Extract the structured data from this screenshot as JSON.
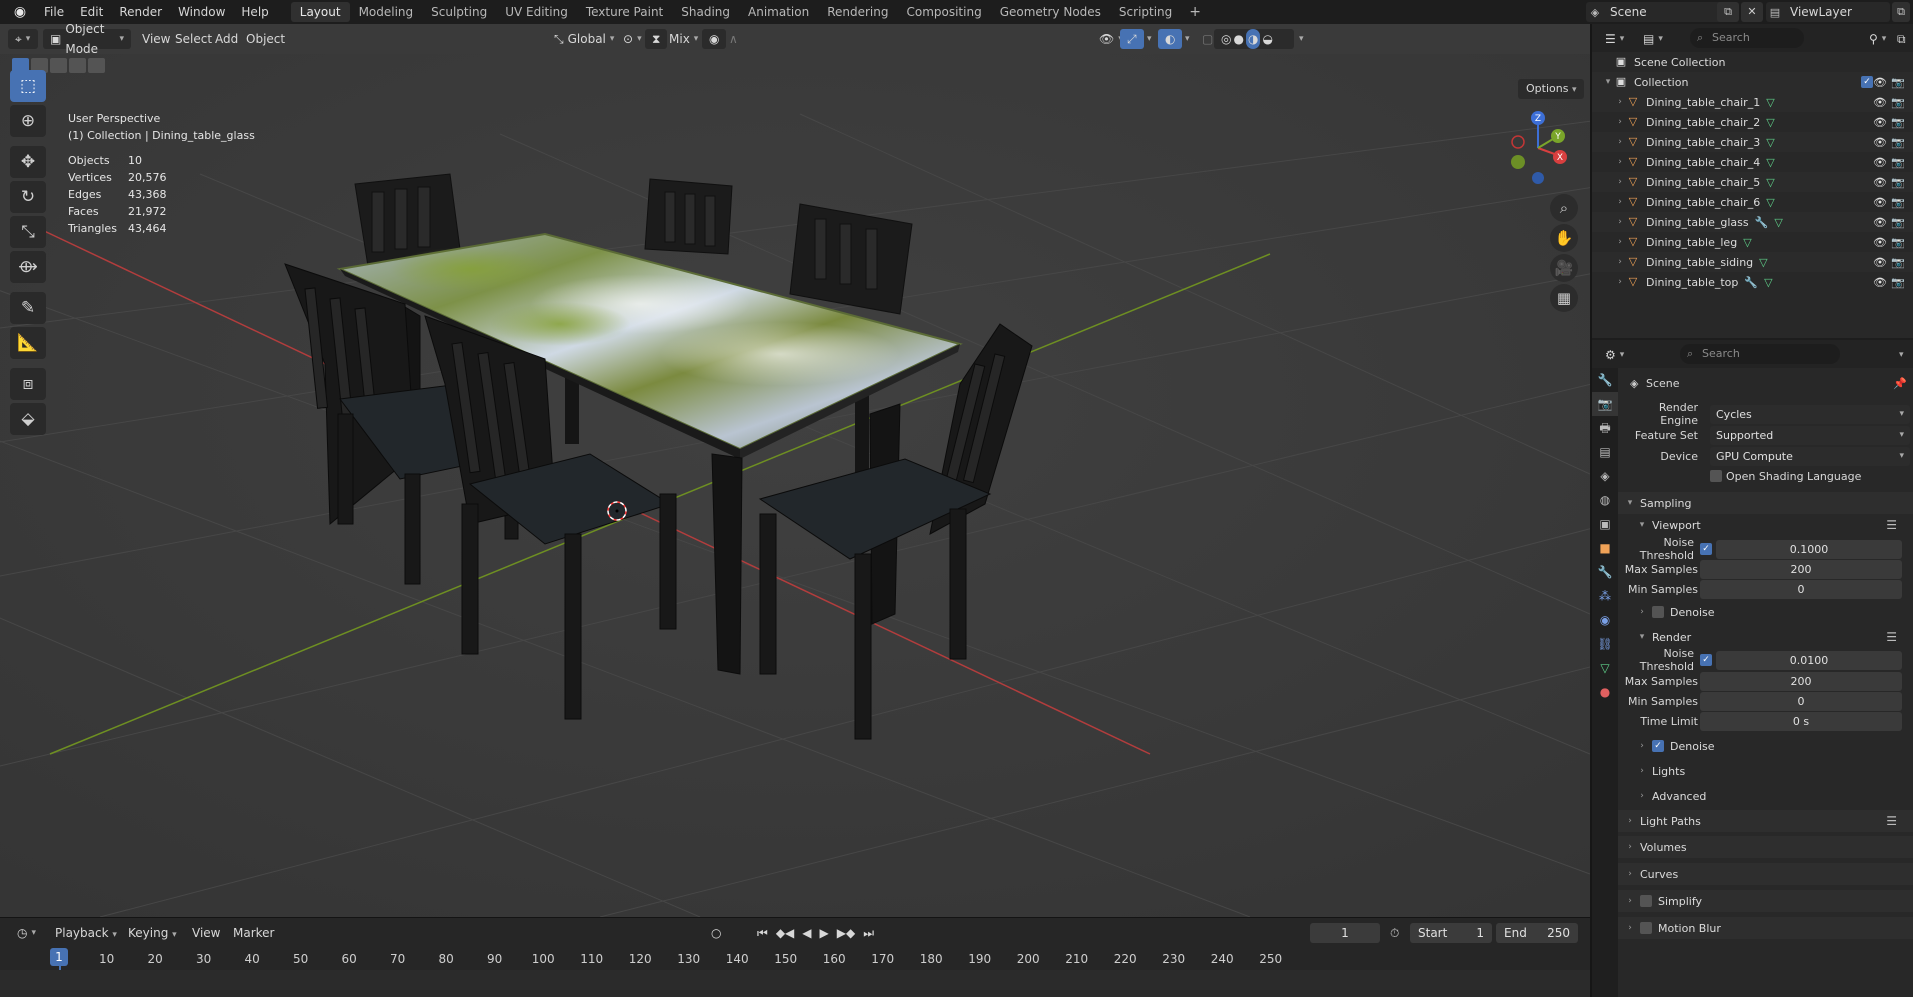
{
  "menu": [
    "File",
    "Edit",
    "Render",
    "Window",
    "Help"
  ],
  "workspaces": [
    "Layout",
    "Modeling",
    "Sculpting",
    "UV Editing",
    "Texture Paint",
    "Shading",
    "Animation",
    "Rendering",
    "Compositing",
    "Geometry Nodes",
    "Scripting"
  ],
  "active_workspace": "Layout",
  "scene_name": "Scene",
  "view_layer": "ViewLayer",
  "viewport": {
    "mode": "Object Mode",
    "menus": [
      "View",
      "Select",
      "Add",
      "Object"
    ],
    "orientation": "Global",
    "snap_mode": "Mix",
    "options_label": "Options",
    "view_name": "User Perspective",
    "context": "(1) Collection | Dining_table_glass",
    "stats": [
      {
        "label": "Objects",
        "value": "10"
      },
      {
        "label": "Vertices",
        "value": "20,576"
      },
      {
        "label": "Edges",
        "value": "43,368"
      },
      {
        "label": "Faces",
        "value": "21,972"
      },
      {
        "label": "Triangles",
        "value": "43,464"
      }
    ],
    "gizmo": {
      "x": "X",
      "y": "Y",
      "z": "Z"
    }
  },
  "timeline": {
    "menus": [
      "Playback",
      "Keying",
      "View",
      "Marker"
    ],
    "current_frame": "1",
    "start_label": "Start",
    "start": "1",
    "end_label": "End",
    "end": "250",
    "ticks": [
      "1",
      "10",
      "20",
      "30",
      "40",
      "50",
      "60",
      "70",
      "80",
      "90",
      "100",
      "110",
      "120",
      "130",
      "140",
      "150",
      "160",
      "170",
      "180",
      "190",
      "200",
      "210",
      "220",
      "230",
      "240",
      "250"
    ]
  },
  "outliner": {
    "search_placeholder": "Search",
    "root": "Scene Collection",
    "collection": "Collection",
    "objects": [
      {
        "name": "Dining_table_chair_1",
        "modifier": false
      },
      {
        "name": "Dining_table_chair_2",
        "modifier": false
      },
      {
        "name": "Dining_table_chair_3",
        "modifier": false
      },
      {
        "name": "Dining_table_chair_4",
        "modifier": false
      },
      {
        "name": "Dining_table_chair_5",
        "modifier": false
      },
      {
        "name": "Dining_table_chair_6",
        "modifier": false
      },
      {
        "name": "Dining_table_glass",
        "modifier": true
      },
      {
        "name": "Dining_table_leg",
        "modifier": false
      },
      {
        "name": "Dining_table_siding",
        "modifier": false
      },
      {
        "name": "Dining_table_top",
        "modifier": true
      }
    ]
  },
  "properties": {
    "search_placeholder": "Search",
    "context_title": "Scene",
    "render_engine_label": "Render Engine",
    "render_engine": "Cycles",
    "feature_set_label": "Feature Set",
    "feature_set": "Supported",
    "device_label": "Device",
    "device": "GPU Compute",
    "osl_label": "Open Shading Language",
    "sampling_label": "Sampling",
    "viewport_label": "Viewport",
    "render_label": "Render",
    "noise_threshold_label": "Noise Threshold",
    "max_samples_label": "Max Samples",
    "min_samples_label": "Min Samples",
    "time_limit_label": "Time Limit",
    "denoise_label": "Denoise",
    "viewport_noise_threshold": "0.1000",
    "viewport_max_samples": "200",
    "viewport_min_samples": "0",
    "render_noise_threshold": "0.0100",
    "render_max_samples": "200",
    "render_min_samples": "0",
    "render_time_limit": "0 s",
    "subpanels": [
      "Lights",
      "Advanced"
    ],
    "panels": [
      "Light Paths",
      "Volumes",
      "Curves",
      "Simplify",
      "Motion Blur"
    ]
  },
  "colors": {
    "accent": "#4772b3",
    "object_icon": "#f0a257",
    "mesh_icon": "#5fd18a",
    "x_axis": "#c03b3b",
    "y_axis": "#7ea02a"
  }
}
